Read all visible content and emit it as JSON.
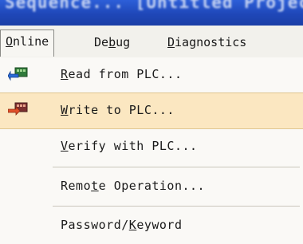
{
  "titlebar": {
    "text": "Sequence...    [Untitled Project]"
  },
  "menubar": {
    "items": [
      {
        "pre": "",
        "key": "O",
        "post": "nline"
      },
      {
        "pre": "De",
        "key": "b",
        "post": "ug"
      },
      {
        "pre": "",
        "key": "D",
        "post": "iagnostics"
      }
    ]
  },
  "dropdown": {
    "items": [
      {
        "pre": "",
        "key": "R",
        "post": "ead from PLC...",
        "icon": "read-from-plc-icon"
      },
      {
        "pre": "",
        "key": "W",
        "post": "rite to PLC...",
        "icon": "write-to-plc-icon",
        "highlighted": true
      },
      {
        "pre": "",
        "key": "V",
        "post": "erify with PLC..."
      },
      {
        "pre": "Remo",
        "key": "t",
        "post": "e Operation..."
      },
      {
        "pre": "Password/",
        "key": "K",
        "post": "eyword"
      }
    ]
  },
  "colors": {
    "highlight": "#fbe7c1",
    "titlebar": "#1f47b8"
  }
}
